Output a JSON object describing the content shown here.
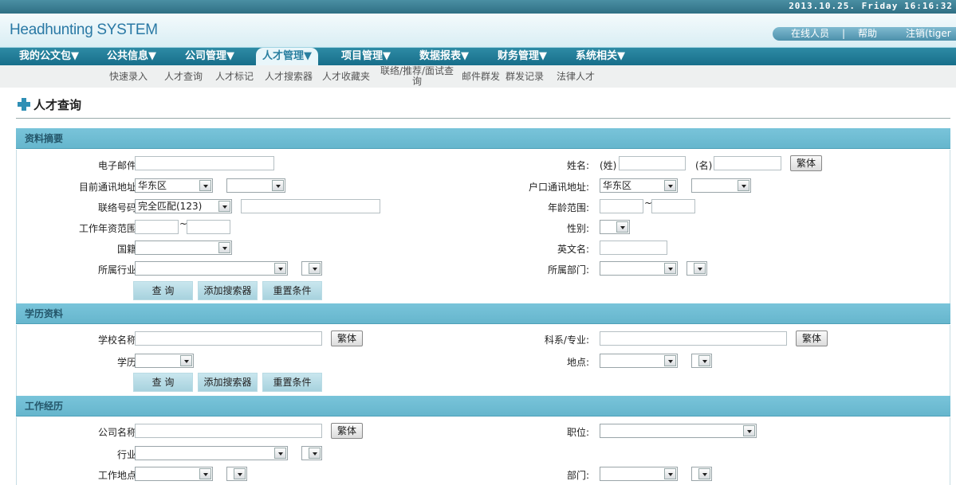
{
  "topbar": {
    "datetime": "2013.10.25. Friday 16:16:32"
  },
  "header": {
    "logo": "Headhunting SYSTEM",
    "links": {
      "online": "在线人员",
      "sep": "|",
      "help": "帮助",
      "logout": "注销(tiger"
    }
  },
  "mainnav": [
    {
      "label": "我的公文包▼"
    },
    {
      "label": "公共信息▼"
    },
    {
      "label": "公司管理▼"
    },
    {
      "label": "人才管理▼"
    },
    {
      "label": "项目管理▼"
    },
    {
      "label": "数据报表▼"
    },
    {
      "label": "财务管理▼"
    },
    {
      "label": "系统相关▼"
    }
  ],
  "subnav": [
    {
      "label": "快速录入"
    },
    {
      "label": "人才查询"
    },
    {
      "label": "人才标记"
    },
    {
      "label": "人才搜索器"
    },
    {
      "label": "人才收藏夹"
    },
    {
      "label": "联络/推荐/面试查",
      "label2": "询"
    },
    {
      "label": "邮件群发"
    },
    {
      "label": "群发记录"
    },
    {
      "label": "法律人才"
    }
  ],
  "page": {
    "title": "人才查询"
  },
  "sections": {
    "summary": {
      "title": "资料摘要",
      "email_label": "电子邮件:",
      "address_label": "目前通讯地址:",
      "address_region": "华东区",
      "phone_label": "联络号码:",
      "phone_match": "完全匹配(123)",
      "work_years_label": "工作年资范围:",
      "nationality_label": "国籍:",
      "industry_label": "所属行业:",
      "name_label": "姓名:",
      "surname_hint": "(姓)",
      "given_hint": "(名)",
      "traditional_btn": "繁体",
      "huji_label": "户口通讯地址:",
      "huji_region": "华东区",
      "age_label": "年龄范围:",
      "gender_label": "性别:",
      "english_name_label": "英文名:",
      "department_label": "所属部门:",
      "tilde": "~"
    },
    "education": {
      "title": "学历资料",
      "school_label": "学校名称:",
      "degree_label": "学历:",
      "major_label": "科系/专业:",
      "location_label": "地点:",
      "traditional_btn": "繁体"
    },
    "work": {
      "title": "工作经历",
      "company_label": "公司名称:",
      "industry_label": "行业:",
      "workplace_label": "工作地点:",
      "position_label": "职位:",
      "department_label": "部门:",
      "traditional_btn": "繁体"
    }
  },
  "buttons": {
    "query": "查 询",
    "add_searcher": "添加搜索器",
    "reset": "重置条件"
  }
}
